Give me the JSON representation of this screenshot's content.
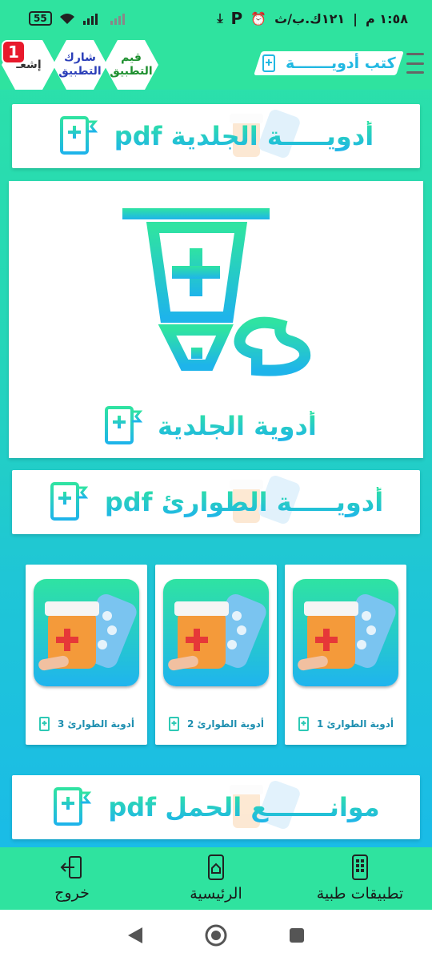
{
  "status_bar": {
    "time": "١:٥٨ م",
    "carrier": "١٢١ك.ب/ث",
    "battery": "55"
  },
  "app_bar": {
    "title": "كتب أدويـــــــة",
    "rate_button": "قيم التطبيق",
    "share_button": "شارك التطبيق",
    "notify_button": "إشعـ",
    "notification_count": "1"
  },
  "banners": [
    {
      "label": "أدويـــــة الجلدية pdf"
    },
    {
      "label": "أدويـــــة الطوارئ pdf"
    },
    {
      "label": "موانـــــــع الحمل pdf"
    }
  ],
  "hero": {
    "title": "أدوية الجلدية"
  },
  "cards": [
    {
      "label": "أدوية الطوارئ 1"
    },
    {
      "label": "أدوية الطوارئ 2"
    },
    {
      "label": "أدوية الطوارئ 3"
    }
  ],
  "bottom_nav": {
    "medical_apps": "تطبيقات طبية",
    "home": "الرئيسية",
    "exit": "خروج"
  },
  "colors": {
    "accent_green": "#2fe39f",
    "accent_blue": "#1eb4ea"
  }
}
